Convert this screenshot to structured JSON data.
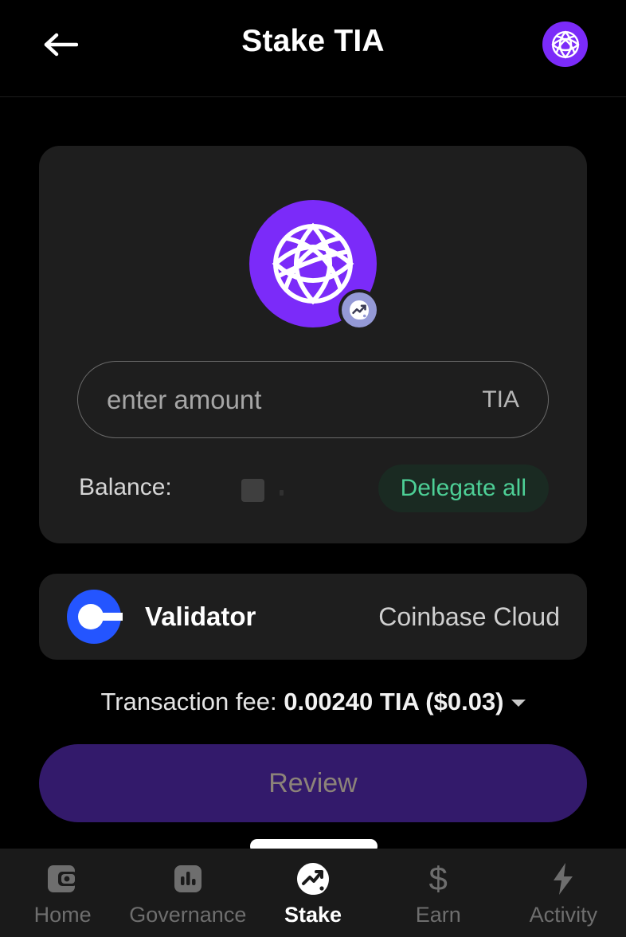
{
  "header": {
    "title": "Stake TIA",
    "back_icon": "arrow-left-icon",
    "avatar_icon": "celestia-logo-icon"
  },
  "amount_card": {
    "token_icon": "celestia-logo-icon",
    "token_badge_icon": "chart-arrow-badge-icon",
    "input": {
      "value": "",
      "placeholder": "enter amount",
      "denom": "TIA"
    },
    "balance": {
      "label": "Balance:",
      "value": "",
      "loading": true
    },
    "delegate_all_label": "Delegate all"
  },
  "validator": {
    "logo_icon": "coinbase-logo-icon",
    "label": "Validator",
    "value": "Coinbase Cloud"
  },
  "fee": {
    "label": "Transaction fee: ",
    "amount": "0.00240 TIA ($0.03)",
    "caret_icon": "chevron-down-icon"
  },
  "primary_action": {
    "label": "Review",
    "disabled": true
  },
  "bottom_nav": {
    "items": [
      {
        "label": "Home",
        "icon": "wallet-icon",
        "active": false
      },
      {
        "label": "Governance",
        "icon": "bar-chart-icon",
        "active": false
      },
      {
        "label": "Stake",
        "icon": "stake-chart-icon",
        "active": true
      },
      {
        "label": "Earn",
        "icon": "dollar-icon",
        "active": false
      },
      {
        "label": "Activity",
        "icon": "lightning-bolt-icon",
        "active": false
      }
    ]
  },
  "colors": {
    "page_background": "#000000",
    "card_background": "#1e1e1e",
    "brand_purple": "#7b2bf9",
    "accent_green": "#4dcf96",
    "coinbase_blue": "#2455ff",
    "primary_button": "#331a6b",
    "nav_background": "#1a1a1a"
  }
}
